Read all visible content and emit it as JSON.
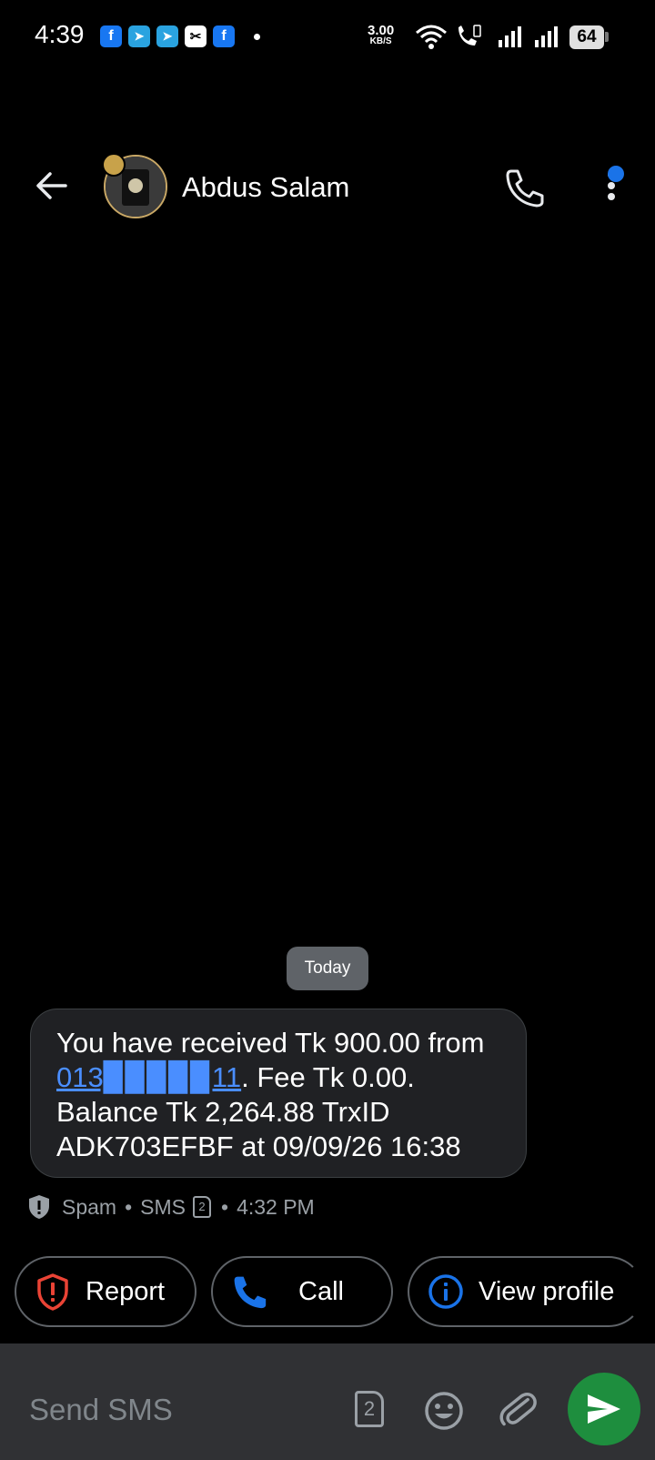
{
  "status_bar": {
    "time": "4:39",
    "notification_icons": [
      {
        "icon": "facebook-icon",
        "glyph": "f",
        "color": "#1877f2"
      },
      {
        "icon": "telegram-icon",
        "glyph": "➤",
        "color": "#2aa3e0"
      },
      {
        "icon": "telegram-icon",
        "glyph": "➤",
        "color": "#2aa3e0"
      },
      {
        "icon": "capcut-icon",
        "glyph": "✂",
        "color": "#000000"
      },
      {
        "icon": "facebook-icon",
        "glyph": "f",
        "color": "#1877f2"
      }
    ],
    "net_speed": "3.00",
    "net_unit": "KB/S",
    "battery": "64"
  },
  "header": {
    "contact_name": "Abdus Salam",
    "has_notification_dot": true
  },
  "conversation": {
    "date_label": "Today",
    "message": {
      "text_before_link": "You  have received Tk 900.00 from ",
      "link_text": "013▉▉▉▉▉11",
      "text_after_link": ". Fee Tk 0.00. Balance Tk 2,264.88 TrxID ADK703EFBF at 09/09/26 16:38"
    },
    "meta": {
      "spam_label": "Spam",
      "channel": "SMS",
      "sim": "2",
      "time": "4:32 PM"
    }
  },
  "actions": {
    "report_label": "Report",
    "call_label": "Call",
    "view_profile_label": "View profile"
  },
  "compose": {
    "placeholder": "Send SMS",
    "sim": "2"
  },
  "colors": {
    "accent_blue": "#1a73e8",
    "send_green": "#1e8e3e",
    "report_red": "#ea4335",
    "bubble_bg": "#202124"
  }
}
